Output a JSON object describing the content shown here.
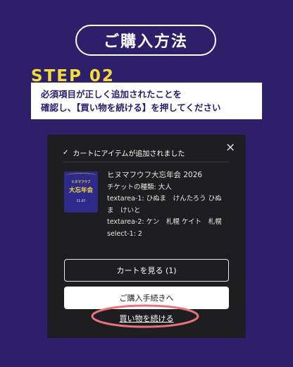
{
  "header": {
    "title": "ご購入方法"
  },
  "step": {
    "label": "STEP 02",
    "instruction_line1": "必須項目が正しく追加されたことを",
    "instruction_line2": "確認し、【買い物を続ける】を押してください"
  },
  "dialog": {
    "notice": "カートにアイテムが追加されました",
    "close_icon": "×",
    "check_icon": "✓",
    "item": {
      "name": "ヒヌマフウフ大忘年会 2026",
      "ticket_type": "チケットの種類: 大人",
      "textarea1": "textarea-1: ひぬま　けんたろう ひぬま　けいと",
      "textarea2": "textarea-2: ケン　札幌 ケイト　札幌",
      "select1": "select-1: 2",
      "thumb_top": "ヒヌマフウフ",
      "thumb_main": "大忘年会",
      "thumb_bottom": "11.07"
    },
    "view_cart_label": "カートを見る (1)",
    "checkout_label": "ご購入手続きへ",
    "continue_label": "買い物を続ける"
  },
  "colors": {
    "background": "#2e1f6b",
    "accent_yellow": "#f4dc3a",
    "highlight_circle": "#e8727a"
  }
}
